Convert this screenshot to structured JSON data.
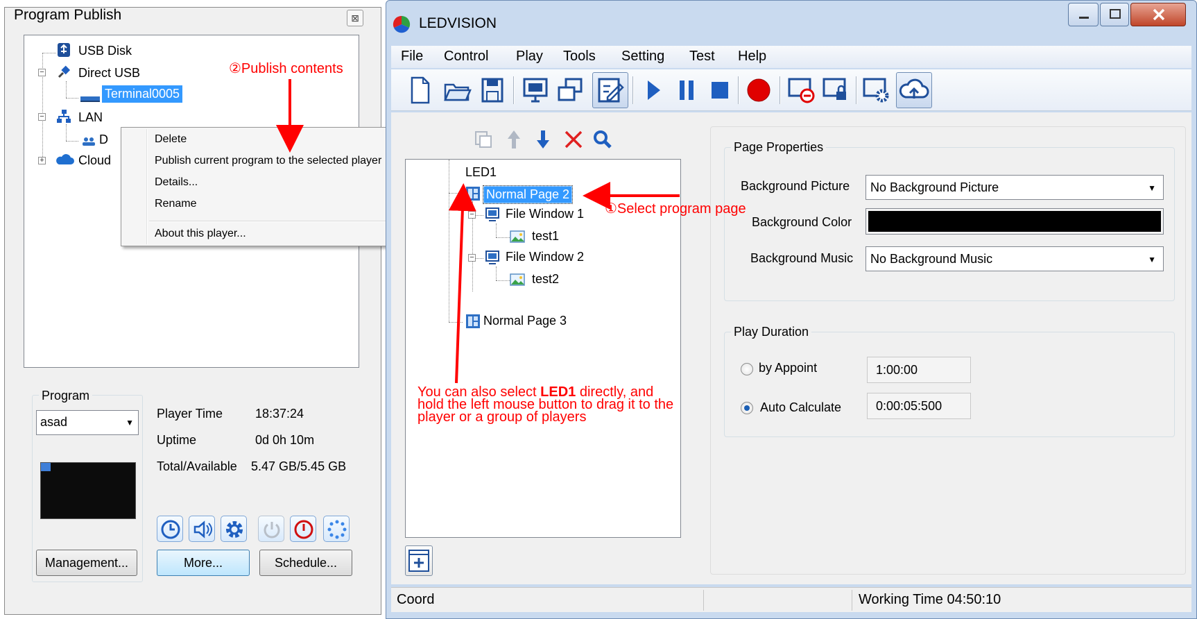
{
  "left_panel": {
    "title": "Program Publish",
    "close_glyph": "⊠",
    "tree": {
      "usb_disk": "USB Disk",
      "direct_usb": "Direct USB",
      "terminal": "Terminal0005",
      "lan": "LAN",
      "lan_child_partial": "D",
      "cloud_partial": "Cloud"
    },
    "context_menu": {
      "items": [
        "Delete",
        "Publish current program to the selected player",
        "Details...",
        "Rename",
        "About this player..."
      ]
    },
    "program": {
      "legend": "Program",
      "selected": "asad"
    },
    "info": {
      "player_time_label": "Player Time",
      "player_time": "18:37:24",
      "uptime_label": "Uptime",
      "uptime": "0d 0h 10m",
      "storage_label": "Total/Available",
      "storage": "5.47 GB/5.45 GB"
    },
    "buttons": {
      "management": "Management...",
      "more": "More...",
      "schedule": "Schedule..."
    }
  },
  "main": {
    "title": "LEDVISION",
    "menu": [
      "File",
      "Control",
      "Play",
      "Tools",
      "Setting",
      "Test",
      "Help"
    ],
    "program_tree": {
      "root": "LED1",
      "page2": "Normal Page 2",
      "file_window_1": "File Window 1",
      "test1": "test1",
      "file_window_2": "File Window 2",
      "test2": "test2",
      "page3": "Normal Page 3"
    },
    "page_properties": {
      "legend": "Page Properties",
      "bg_picture_label": "Background Picture",
      "bg_picture_value": "No Background Picture",
      "bg_color_label": "Background Color",
      "bg_color_value": "#000000",
      "bg_music_label": "Background Music",
      "bg_music_value": "No Background Music"
    },
    "play_duration": {
      "legend": "Play Duration",
      "by_appoint_label": "by Appoint",
      "by_appoint_value": "1:00:00",
      "auto_calc_label": "Auto Calculate",
      "auto_calc_value": "0:00:05:500"
    },
    "status": {
      "coord": "Coord",
      "working_time": "Working Time 04:50:10"
    }
  },
  "annotations": {
    "publish": "②Publish contents",
    "select_page": "①Select program page",
    "drag_line1_pre": "You can also select ",
    "drag_line1_bold": "LED1",
    "drag_line1_post": " directly, and",
    "drag_line2": "hold the left mouse button to drag it to the",
    "drag_line3": "player or a group of players"
  },
  "colors": {
    "selection": "#3399ff",
    "annotation": "#ff0000",
    "window_frame": "#c9daef"
  }
}
